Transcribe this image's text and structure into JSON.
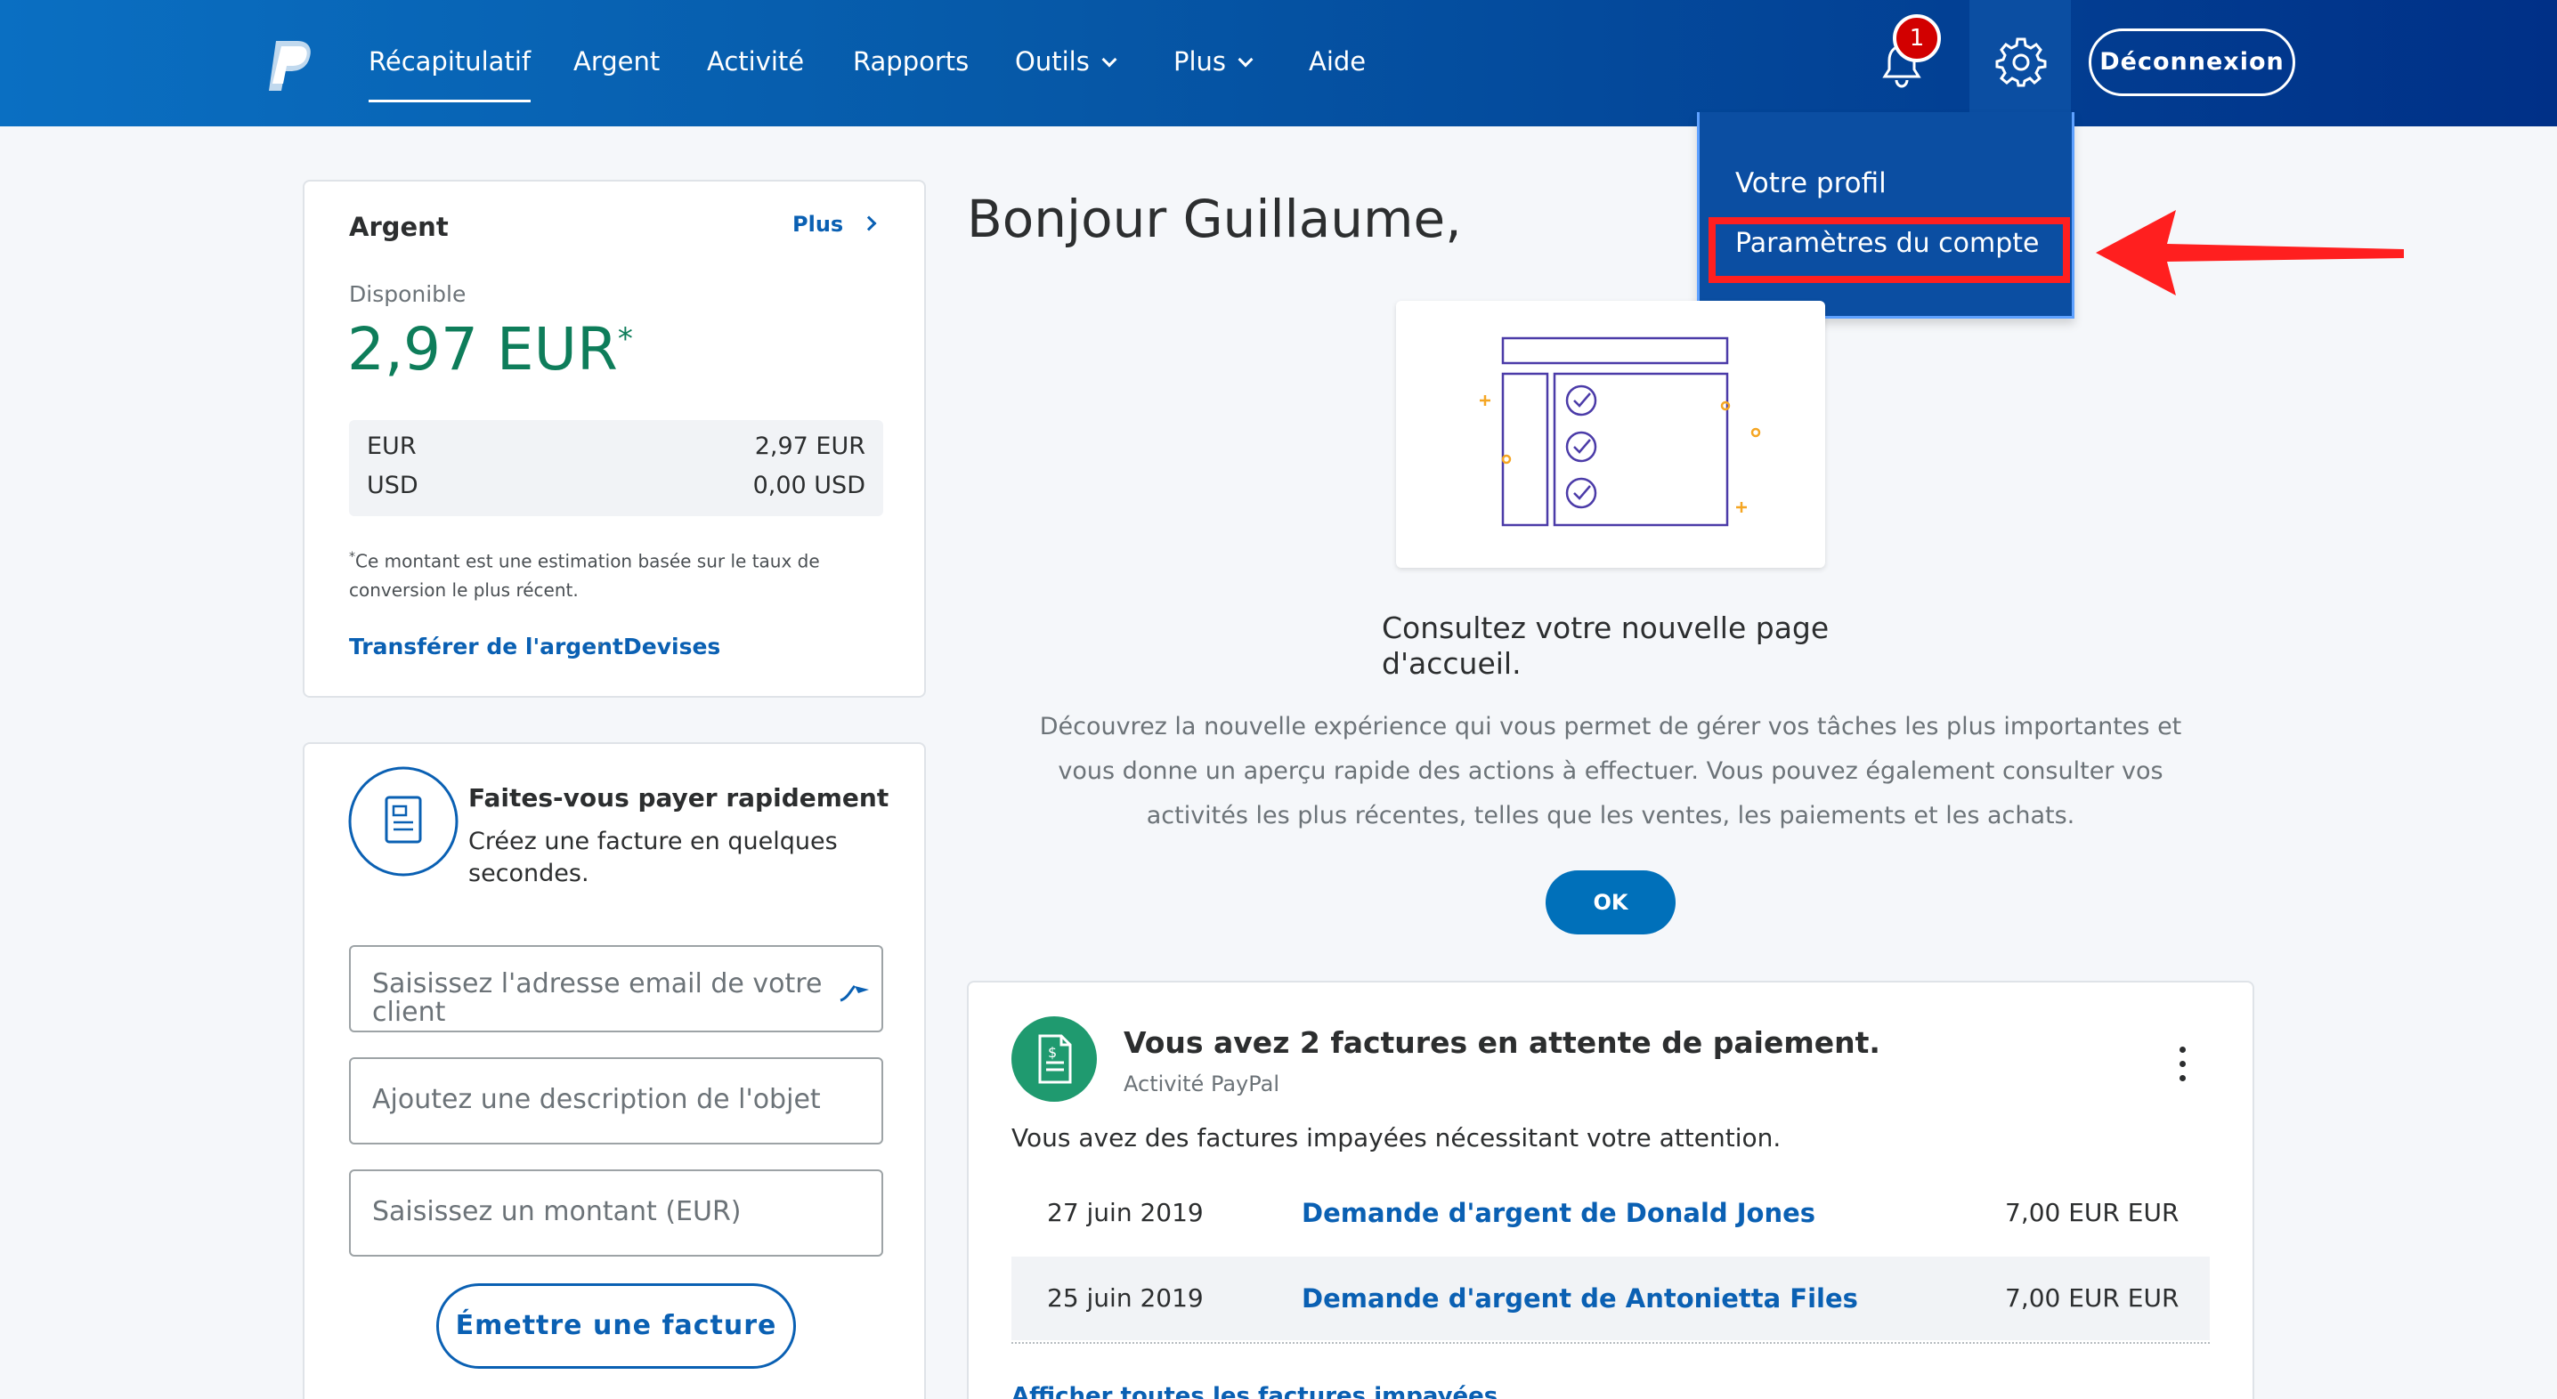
{
  "nav": {
    "items": [
      "Récapitulatif",
      "Argent",
      "Activité",
      "Rapports",
      "Outils",
      "Plus",
      "Aide"
    ],
    "notification_count": "1",
    "logout_label": "Déconnexion"
  },
  "dropdown": {
    "profile_label": "Votre profil",
    "settings_label": "Paramètres du compte"
  },
  "money_card": {
    "title": "Argent",
    "more_label": "Plus",
    "available_label": "Disponible",
    "total": "2,97 EUR",
    "asterisk": "*",
    "balances": [
      {
        "currency": "EUR",
        "amount": "2,97 EUR"
      },
      {
        "currency": "USD",
        "amount": "0,00 USD"
      }
    ],
    "note_line1": "Ce montant est une estimation basée sur le taux de",
    "note_line2": "conversion le plus récent.",
    "transfer_label": "Transférer de l'argent",
    "separator": "·",
    "currencies_label": "Devises"
  },
  "invoice_card": {
    "title": "Faites-vous payer rapidement",
    "subtitle_line1": "Créez une facture en quelques",
    "subtitle_line2": "secondes.",
    "email_placeholder_line1": "Saisissez l'adresse email de votre",
    "email_placeholder_line2": "client",
    "description_placeholder": "Ajoutez une description de l'objet",
    "amount_placeholder": "Saisissez un montant (EUR)",
    "issue_button": "Émettre une facture"
  },
  "main": {
    "greeting": "Bonjour Guillaume,",
    "promo_title_line1": "Consultez votre nouvelle page",
    "promo_title_line2": "d'accueil.",
    "promo_text_line1": "Découvrez la nouvelle expérience qui vous permet de gérer vos tâches les plus importantes et",
    "promo_text_line2": "vous donne un aperçu rapide des actions à effectuer. Vous pouvez également consulter vos",
    "promo_text_line3": "activités les plus récentes, telles que les ventes, les paiements et les achats.",
    "ok_label": "OK"
  },
  "pending_card": {
    "title": "Vous avez 2 factures en attente de paiement.",
    "source": "Activité PayPal",
    "description": "Vous avez des factures impayées nécessitant votre attention.",
    "rows": [
      {
        "date": "27 juin 2019",
        "label": "Demande d'argent de Donald Jones",
        "amount": "7,00 EUR EUR"
      },
      {
        "date": "25 juin 2019",
        "label": "Demande d'argent de Antonietta Files",
        "amount": "7,00 EUR EUR"
      }
    ],
    "see_all_label": "Afficher toutes les factures impayées"
  },
  "colors": {
    "nav_start": "#0a6fc2",
    "nav_end": "#003087",
    "balance_green": "#0e7d5a",
    "link_blue": "#0a60b3",
    "highlight_red": "#ff1f1f",
    "invoice_icon_green": "#1f9a6f"
  }
}
